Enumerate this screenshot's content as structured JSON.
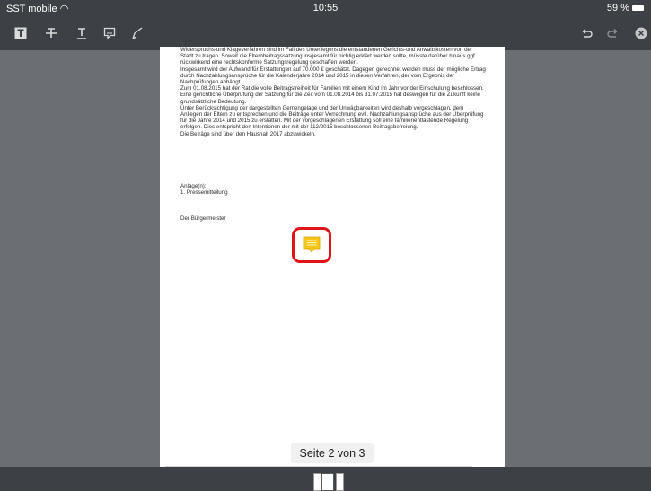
{
  "status": {
    "carrier": "SST mobile",
    "time": "10:55",
    "battery": "59 %"
  },
  "toolbar": {
    "left_tools": [
      "text-box-icon",
      "strikethrough-icon",
      "underline-icon",
      "note-icon",
      "pen-icon"
    ],
    "right_tools": [
      "undo-icon",
      "redo-icon",
      "close-icon"
    ]
  },
  "document": {
    "paragraphs": [
      "Widerspruchs-und Klageverfahren sind im Fall des Unterliegens die entstandenen Gerichts-und Anwaltskosten von der Stadt zu tragen. Soweit die Elternbeitragssatzung insgesamt für nichtig erklärt werden sollte, müsste darüber hinaus ggf. rückwirkend eine rechtskonforme Satzungsregelung geschaffen werden.",
      "Insgesamt wird der Aufwand für Erstattungen auf 70.000 € geschätzt. Dagegen gerechnet werden muss der mögliche Ertrag durch Nachzahlungsansprüche für die Kalenderjahre 2014 und 2015 in diesen Verfahren, der vom Ergebnis der Nachprüfungen abhängt.",
      "Zum 01.08.2015 hat der Rat die volle Beitragsfreiheit für Familien mit einem Kind im Jahr vor der Einschulung beschlossen. Eine gerichtliche Überprüfung der Satzung für die Zeit vom 01.08.2014 bis 31.07.2015 hat deswegen für die Zukunft keine grundsätzliche Bedeutung.",
      "Unter Berücksichtigung der dargestellten Gemengelage und der Unwägbarkeiten wird deshalb vorgeschlagen, dem Anliegen der Eltern zu entsprechen und die Beiträge unter Verrechnung evtl. Nachzahlungsansprüche aus der Überprüfung für die Jahre 2014 und 2015 zu erstatten. Mit der vorgeschlagenen Erstattung soll eine familienentlastende Regelung erfolgen. Dies entspricht den Intentionen der mit der 112/2015 beschlossenen Beitragsbefreiung.",
      "Die Beträge sind über den Haushalt 2017 abzuwickeln."
    ],
    "attachments_heading": "Anlage(n):",
    "attachments": [
      "1.   Pressemitteilung"
    ],
    "signature": "Der Bürgermeister"
  },
  "page_indicator": "Seite 2 von 3",
  "colors": {
    "bars": "#3d4044",
    "background": "#6b6e72",
    "highlight": "#e0131a",
    "note": "#f5c518"
  }
}
